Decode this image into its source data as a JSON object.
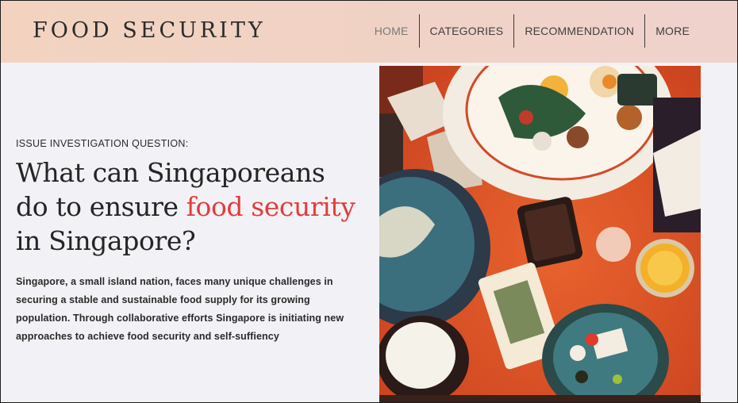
{
  "header": {
    "brand": "FOOD SECURITY",
    "nav": [
      "HOME",
      "CATEGORIES",
      "RECOMMENDATION",
      "MORE"
    ]
  },
  "main": {
    "eyebrow": "ISSUE INVESTIGATION QUESTION:",
    "headline": {
      "part1": "What can Singaporeans do to ensure ",
      "highlight1": "food",
      "space": " ",
      "highlight2": "security",
      "part2": " in Singapore?"
    },
    "body": "Singapore, a small island nation, faces many unique challenges in securing a stable and sustainable food supply for its growing population. Through collaborative efforts Singapore is initiating new approaches to achieve food security and self-suffiency"
  },
  "colors": {
    "header_bg": "#f2d3c4",
    "highlight": "#e23c3c",
    "page_bg": "#f2f2f6",
    "art_bg": "#e05a2c"
  },
  "icons": {
    "hero_image": "food-table-illustration"
  }
}
